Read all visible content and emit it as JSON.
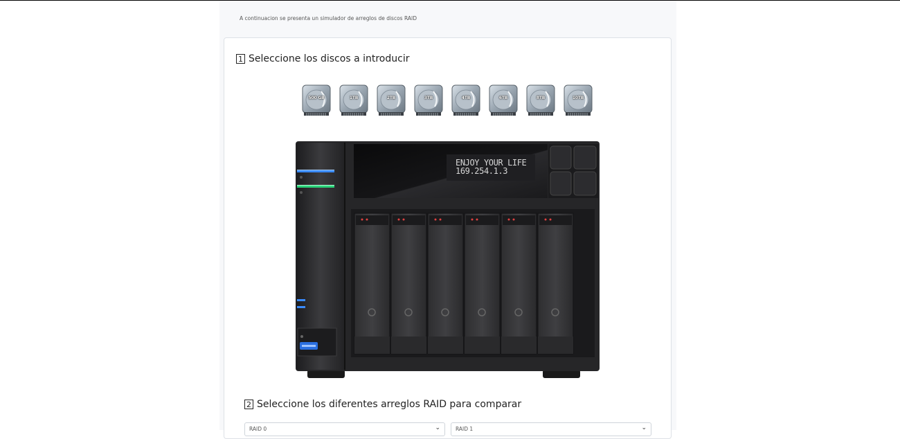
{
  "page": {
    "intro": "A continuacion se presenta un simulador de arreglos de discos RAID"
  },
  "step1": {
    "number": "1",
    "label": "Seleccione los discos a introducir"
  },
  "disks": [
    {
      "label": "500 GB"
    },
    {
      "label": "1TB"
    },
    {
      "label": "2TB"
    },
    {
      "label": "3TB"
    },
    {
      "label": "4TB"
    },
    {
      "label": "6TB"
    },
    {
      "label": "8TB"
    },
    {
      "label": "10TB"
    }
  ],
  "nas": {
    "lcd_line1": "ENJOY YOUR LIFE",
    "lcd_line2": "169.254.1.3",
    "bay_count": 6
  },
  "step2": {
    "number": "2",
    "label": "Seleccione los diferentes arreglos RAID para comparar"
  },
  "raid_selects": [
    {
      "value": "RAID 0"
    },
    {
      "value": "RAID 1"
    }
  ],
  "colors": {
    "accent_blue": "#3a8bff",
    "accent_green": "#2bd47a",
    "nas_body": "#2b2b2d"
  }
}
